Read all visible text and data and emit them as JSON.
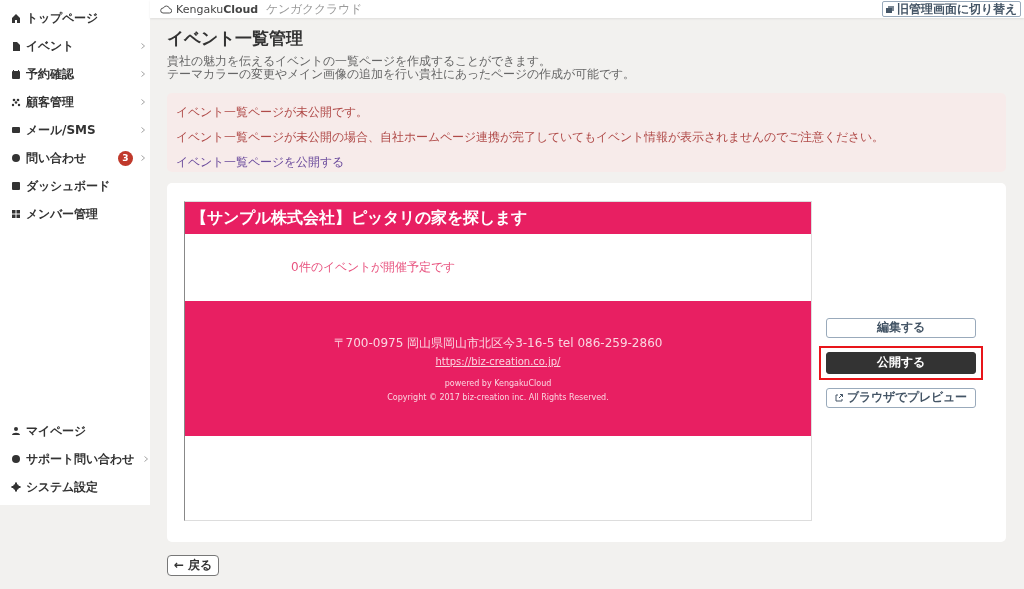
{
  "header": {
    "logo": "Kengaku**Cloud**",
    "logo_sub": "ケンガククラウド",
    "switch_button": "旧管理画面に切り替え"
  },
  "sidebar": {
    "items": [
      {
        "label": "トップページ",
        "has_submenu": false
      },
      {
        "label": "イベント",
        "has_submenu": true
      },
      {
        "label": "予約確認",
        "has_submenu": true
      },
      {
        "label": "顧客管理",
        "has_submenu": true
      },
      {
        "label": "メール/SMS",
        "has_submenu": true
      },
      {
        "label": "問い合わせ",
        "has_submenu": true,
        "badge": "3"
      },
      {
        "label": "ダッシュボード",
        "has_submenu": false
      },
      {
        "label": "メンバー管理",
        "has_submenu": false
      }
    ],
    "bottom_items": [
      {
        "label": "マイページ",
        "has_submenu": false
      },
      {
        "label": "サポート問い合わせ",
        "has_submenu": true
      },
      {
        "label": "システム設定",
        "has_submenu": false
      }
    ]
  },
  "page": {
    "title": "イベント一覧管理",
    "description": [
      "貴社の魅力を伝えるイベントの一覧ページを作成することができます。",
      "テーマカラーの変更やメイン画像の追加を行い貴社にあったページの作成が可能です。"
    ]
  },
  "alert": {
    "lines": [
      "イベント一覧ページが未公開です。",
      "イベント一覧ページが未公開の場合、自社ホームページ連携が完了していてもイベント情報が表示されませんのでご注意ください。"
    ],
    "link": "イベント一覧ページを公開する"
  },
  "preview": {
    "heading": "【サンプル株式会社】ピッタリの家を探します",
    "event_count": "0件のイベントが開催予定です",
    "footer": {
      "address": "〒700-0975 岡山県岡山市北区今3-16-5 tel 086-259-2860",
      "url": "https://biz-creation.co.jp/",
      "powered": "powered by KengakuCloud",
      "copyright": "Copyright © 2017 biz-creation inc. All Rights Reserved."
    }
  },
  "actions": [
    {
      "label": "編集する",
      "kind": "outline",
      "highlighted": false
    },
    {
      "label": "公開する",
      "kind": "primary",
      "highlighted": true
    },
    {
      "label": "ブラウザでプレビュー",
      "kind": "external",
      "highlighted": false
    }
  ],
  "back_button": "← 戻る"
}
